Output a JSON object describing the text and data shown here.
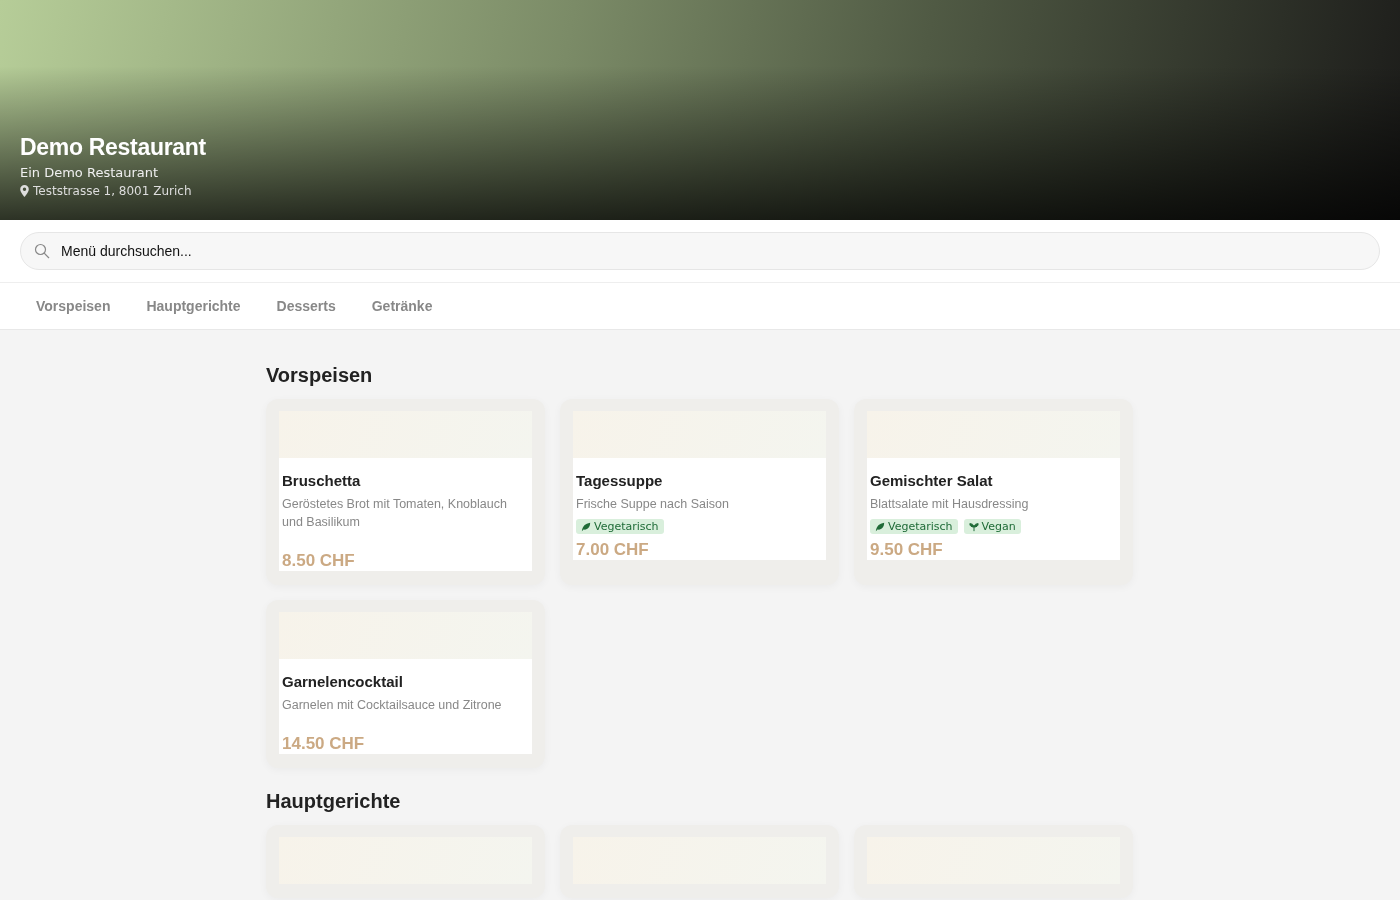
{
  "header": {
    "title": "Demo Restaurant",
    "subtitle": "Ein Demo Restaurant",
    "address": "Teststrasse 1, 8001 Zurich"
  },
  "search": {
    "placeholder": "Menü durchsuchen..."
  },
  "tabs": [
    {
      "label": "Vorspeisen",
      "selected": false
    },
    {
      "label": "Hauptgerichte",
      "selected": false
    },
    {
      "label": "Desserts",
      "selected": false
    },
    {
      "label": "Getränke",
      "selected": false
    }
  ],
  "sections": [
    {
      "title": "Vorspeisen",
      "items": [
        {
          "name": "Bruschetta",
          "description": "Geröstetes Brot mit Tomaten, Knoblauch und Basilikum",
          "price": "8.50 CHF"
        },
        {
          "name": "Tagessuppe",
          "description": "Frische Suppe nach Saison",
          "tags": [
            {
              "kind": "vegetarian",
              "label": "Vegetarisch"
            }
          ],
          "price": "7.00 CHF"
        },
        {
          "name": "Gemischter Salat",
          "description": "Blattsalate mit Hausdressing",
          "tags": [
            {
              "kind": "vegetarian",
              "label": "Vegetarisch"
            },
            {
              "kind": "vegan",
              "label": "Vegan"
            }
          ],
          "price": "9.50 CHF"
        },
        {
          "name": "Garnelencocktail",
          "description": "Garnelen mit Cocktailsauce und Zitrone",
          "price": "14.50 CHF"
        }
      ]
    },
    {
      "title": "Hauptgerichte"
    }
  ]
}
